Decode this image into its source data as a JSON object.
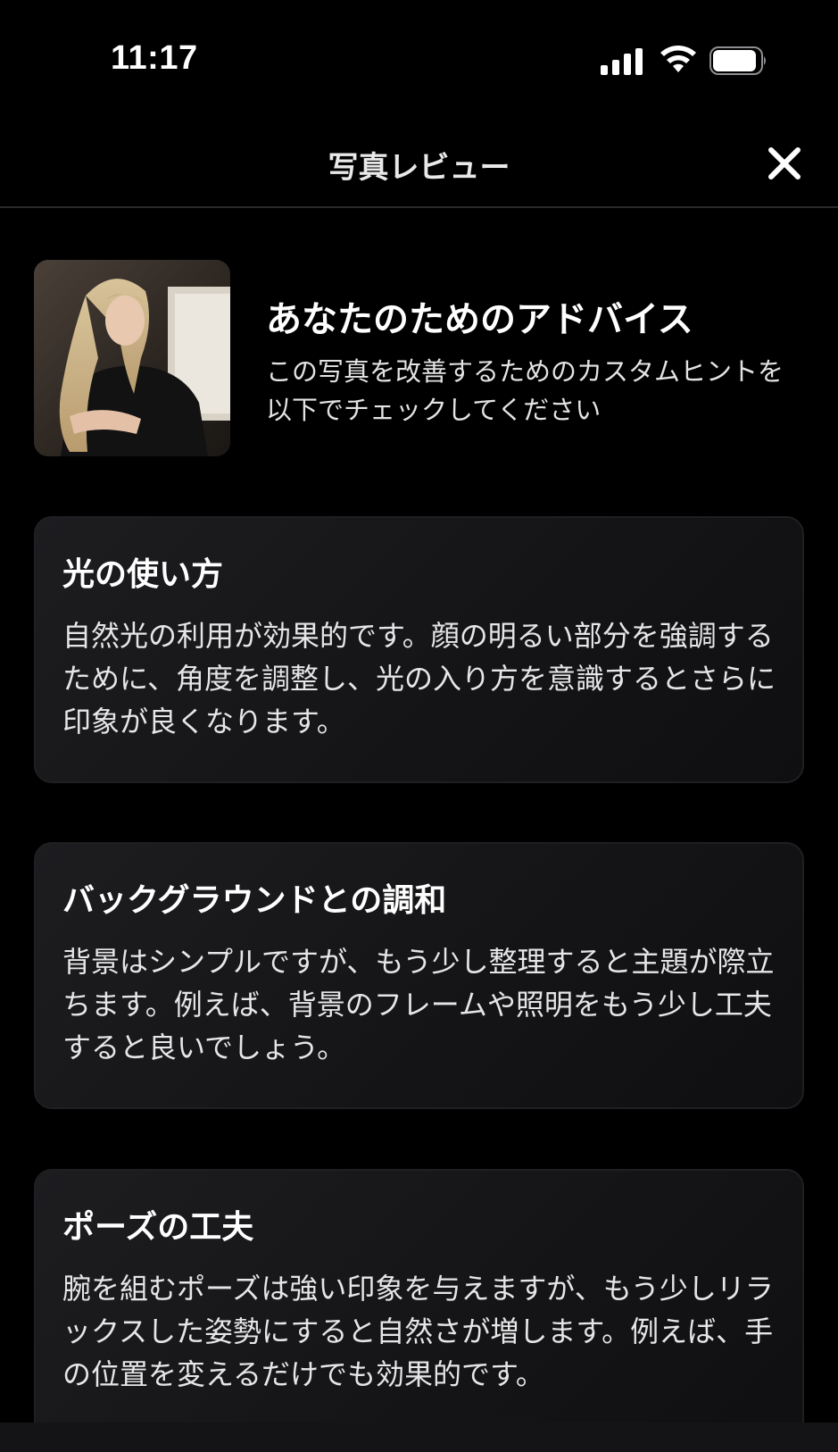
{
  "status_bar": {
    "time": "11:17"
  },
  "header": {
    "title": "写真レビュー",
    "close_icon": "close-icon"
  },
  "intro": {
    "title": "あなたのためのアドバイス",
    "subtitle": "この写真を改善するためのカスタムヒントを以下でチェックしてください"
  },
  "cards": [
    {
      "title": "光の使い方",
      "body": "自然光の利用が効果的です。顔の明るい部分を強調するために、角度を調整し、光の入り方を意識するとさらに印象が良くなります。"
    },
    {
      "title": "バックグラウンドとの調和",
      "body": "背景はシンプルですが、もう少し整理すると主題が際立ちます。例えば、背景のフレームや照明をもう少し工夫すると良いでしょう。"
    },
    {
      "title": "ポーズの工夫",
      "body": "腕を組むポーズは強い印象を与えますが、もう少しリラックスした姿勢にすると自然さが増します。例えば、手の位置を変えるだけでも効果的です。"
    }
  ],
  "colors": {
    "background": "#000000",
    "card": "#161618",
    "text_primary": "#ffffff",
    "text_secondary": "#e6e6e7"
  }
}
